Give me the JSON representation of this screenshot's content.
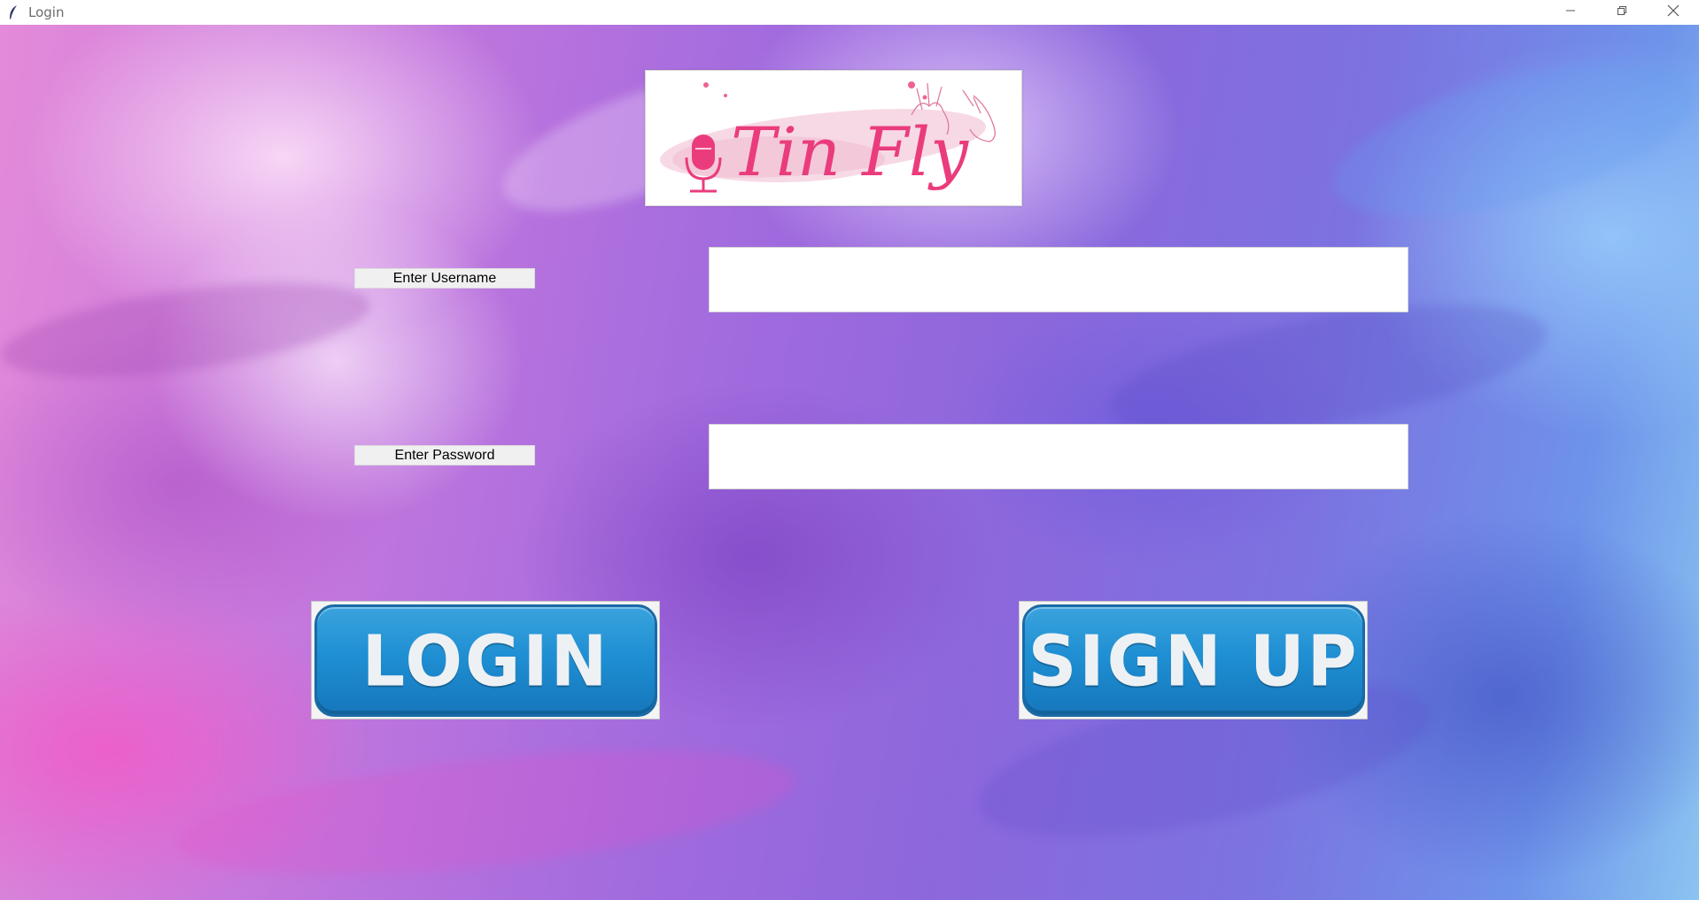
{
  "window": {
    "title": "Login",
    "app_icon": "feather-icon",
    "controls": [
      "minimize-icon",
      "restore-icon",
      "close-icon"
    ]
  },
  "logo": {
    "text": "Tin Fly",
    "mic_icon": "microphone-icon",
    "accent_color": "#ea3c7c"
  },
  "form": {
    "username_label": "Enter Username",
    "username_value": "",
    "password_label": "Enter Password",
    "password_value": ""
  },
  "buttons": {
    "login_label": "LOGIN",
    "signup_label": "SIGN UP",
    "color": "#1f8fd3"
  }
}
